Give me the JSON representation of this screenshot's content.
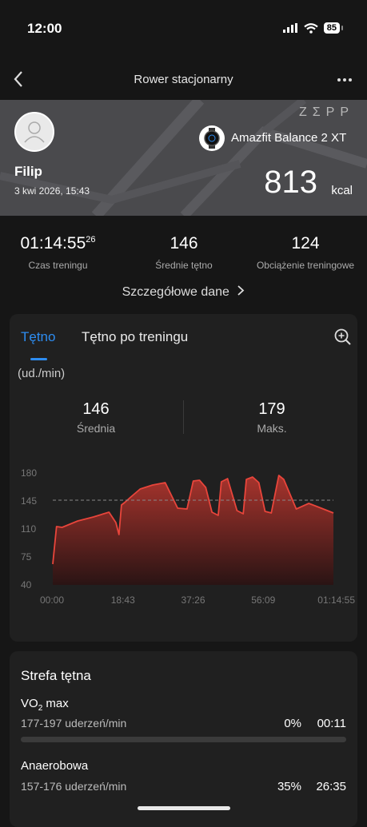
{
  "status": {
    "time": "12:00",
    "battery": "85"
  },
  "nav": {
    "title": "Rower stacjonarny"
  },
  "header": {
    "brand": "ZΣPP",
    "user": "Filip",
    "date": "3 kwi 2026, 15:43",
    "device": "Amazfit Balance 2 XT",
    "calories": "813",
    "calories_unit": "kcal"
  },
  "stats": [
    {
      "value": "01:14:55",
      "sup": "26",
      "label": "Czas treningu"
    },
    {
      "value": "146",
      "label": "Średnie tętno"
    },
    {
      "value": "124",
      "label": "Obciążenie treningowe"
    }
  ],
  "details_link": "Szczegółowe dane",
  "tabs": [
    "Tętno",
    "Tętno po treningu"
  ],
  "hr": {
    "unit": "(ud./min)",
    "avg": "146",
    "avg_label": "Średnia",
    "max": "179",
    "max_label": "Maks."
  },
  "chart_data": {
    "type": "area",
    "x_ticks": [
      "00:00",
      "18:43",
      "37:26",
      "56:09",
      "01:14:55"
    ],
    "y_ticks": [
      180,
      145,
      110,
      75,
      40
    ],
    "ylim": [
      40,
      180
    ],
    "xlim": [
      0,
      4495
    ],
    "reference_line": 146,
    "x": [
      0,
      60,
      150,
      400,
      650,
      900,
      1010,
      1060,
      1100,
      1150,
      1250,
      1400,
      1600,
      1800,
      2000,
      2150,
      2250,
      2350,
      2450,
      2550,
      2650,
      2700,
      2800,
      2950,
      3050,
      3100,
      3200,
      3300,
      3400,
      3500,
      3620,
      3700,
      3900,
      4100,
      4300,
      4495
    ],
    "y": [
      66,
      113,
      112,
      120,
      125,
      131,
      118,
      103,
      140,
      143,
      150,
      160,
      165,
      168,
      136,
      135,
      170,
      171,
      162,
      131,
      127,
      169,
      173,
      133,
      129,
      172,
      175,
      168,
      132,
      130,
      177,
      172,
      135,
      142,
      136,
      130
    ],
    "colors": {
      "line": "#e8453b",
      "fill_top": "#a8342d",
      "fill_bottom": "#2a1414",
      "ref": "#888888"
    }
  },
  "zones": {
    "title": "Strefa tętna",
    "items": [
      {
        "name": "VO",
        "sub": "2",
        "name_rest": " max",
        "range": "177-197 uderzeń/min",
        "percent": "0%",
        "time": "00:11"
      },
      {
        "name": "Anaerobowa",
        "range": "157-176 uderzeń/min",
        "percent": "35%",
        "time": "26:35"
      }
    ]
  }
}
